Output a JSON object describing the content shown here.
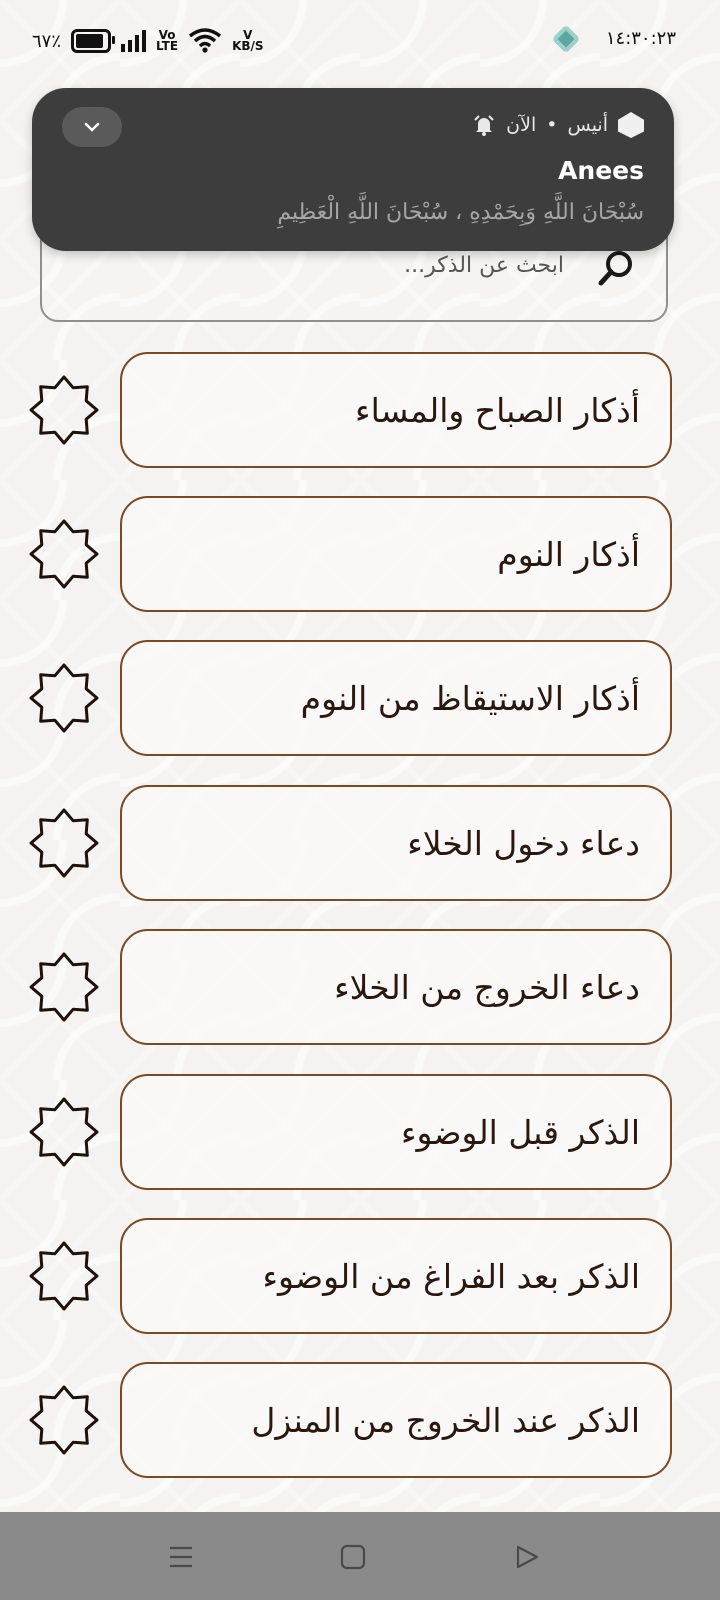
{
  "status_bar": {
    "battery": "٦٧٪",
    "network_top": "Vo",
    "network_bottom": "LTE",
    "speed_top": "V",
    "speed_bottom": "KB/S",
    "time": "١٤:٣٠:٢٣"
  },
  "notification": {
    "app_name": "أنيس",
    "separator": "•",
    "when": "الآن",
    "title": "Anees",
    "body": "سُبْحَانَ اللَّهِ وَبِحَمْدِهِ ، سُبْحَانَ اللَّهِ الْعَظِيمِ"
  },
  "search": {
    "placeholder": "ابحث عن الذكر..."
  },
  "azkar_list": [
    {
      "label": "أذكار الصباح والمساء"
    },
    {
      "label": "أذكار النوم"
    },
    {
      "label": "أذكار الاستيقاظ من النوم"
    },
    {
      "label": "دعاء دخول الخلاء"
    },
    {
      "label": "دعاء الخروج من الخلاء"
    },
    {
      "label": "الذكر قبل الوضوء"
    },
    {
      "label": "الذكر بعد الفراغ من الوضوء"
    },
    {
      "label": "الذكر عند الخروج من المنزل"
    }
  ],
  "colors": {
    "card_border": "#7a4a22",
    "notification_bg": "#3d3d3d",
    "nav_bar_bg": "#8a8a8a"
  },
  "icons": {
    "list_item": "eight-point-star-icon",
    "search": "search-icon",
    "nav": [
      "menu-icon",
      "home-icon",
      "back-icon"
    ]
  }
}
